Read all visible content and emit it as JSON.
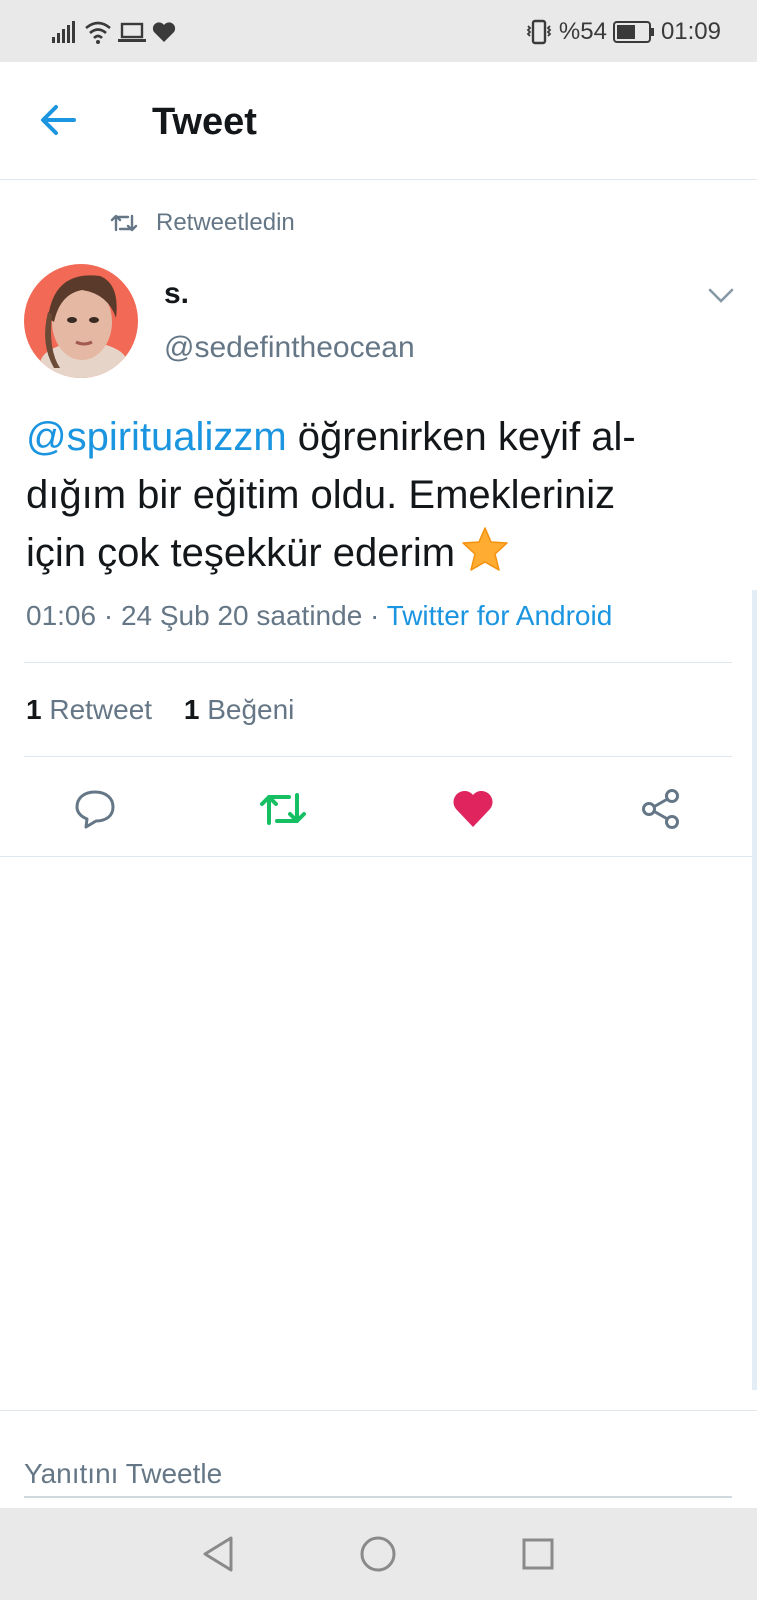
{
  "status_bar": {
    "battery": "%54",
    "time": "01:09",
    "icons": [
      "signal-icon",
      "wifi-icon",
      "laptop-icon",
      "heart-icon",
      "vibrate-icon",
      "battery-icon"
    ]
  },
  "header": {
    "title": "Tweet",
    "back_icon": "arrow-left-icon"
  },
  "retweet_context": {
    "label": "Retweetledin"
  },
  "author": {
    "name": "s.",
    "handle": "@sedefintheocean"
  },
  "tweet": {
    "mention": "@spiritualizzm",
    "line1_rest": " öğrenirken keyif al-",
    "line2": "dığım bir eğitim oldu. Emekleriniz",
    "line3": "için çok teşekkür ederim",
    "emoji": "star-emoji"
  },
  "meta": {
    "timestamp": "01:06 · 24 Şub 20 saatinde · ",
    "source": "Twitter for Android"
  },
  "stats": {
    "retweet_count": "1",
    "retweet_label": "Retweet",
    "like_count": "1",
    "like_label": "Beğeni"
  },
  "actions": [
    {
      "name": "reply",
      "icon": "comment-icon"
    },
    {
      "name": "retweet",
      "icon": "retweet-icon",
      "active": true,
      "color": "#17bf63"
    },
    {
      "name": "like",
      "icon": "heart-icon",
      "active": true,
      "color": "#e0245e"
    },
    {
      "name": "share",
      "icon": "share-icon"
    }
  ],
  "reply_composer": {
    "placeholder": "Yanıtını Tweetle"
  },
  "colors": {
    "accent": "#1b95e0",
    "secondary_text": "#657786",
    "retweet_green": "#17bf63",
    "like_red": "#e0245e"
  }
}
